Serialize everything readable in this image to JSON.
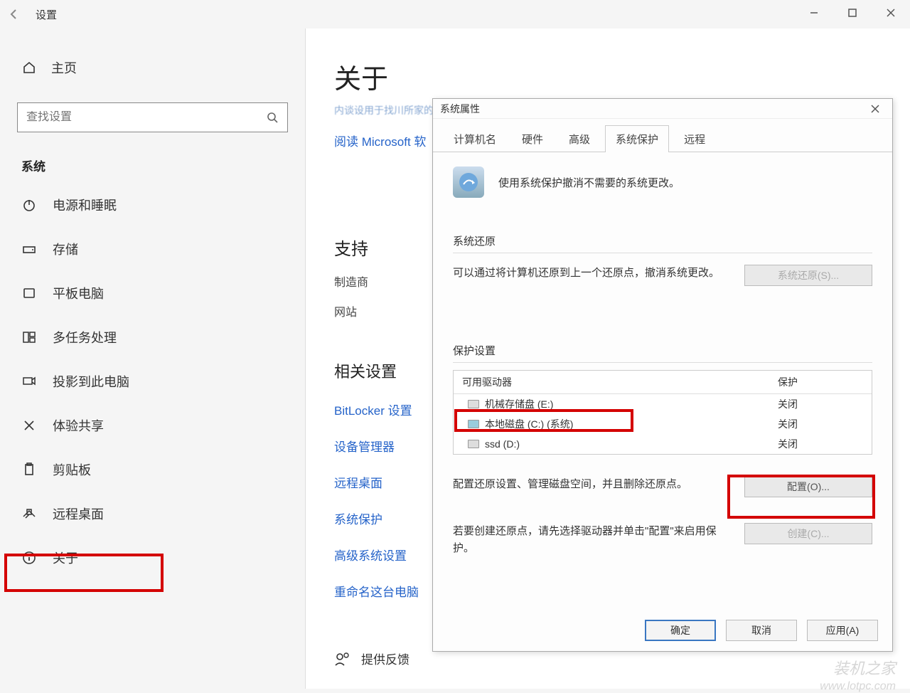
{
  "titlebar": {
    "title": "设置"
  },
  "sidebar": {
    "home": "主页",
    "search_placeholder": "查找设置",
    "section": "系统",
    "items": [
      {
        "label": "电源和睡眠"
      },
      {
        "label": "存储"
      },
      {
        "label": "平板电脑"
      },
      {
        "label": "多任务处理"
      },
      {
        "label": "投影到此电脑"
      },
      {
        "label": "体验共享"
      },
      {
        "label": "剪贴板"
      },
      {
        "label": "远程桌面"
      },
      {
        "label": "关于"
      }
    ]
  },
  "main": {
    "title": "关于",
    "blurred_text": "内谈设用于找川所家的 Microsoft 所家的议",
    "link": "阅读 Microsoft 软",
    "support_title": "支持",
    "manufacturer": "制造商",
    "website": "网站",
    "related_title": "相关设置",
    "related": [
      "BitLocker 设置",
      "设备管理器",
      "远程桌面",
      "系统保护",
      "高级系统设置",
      "重命名这台电脑"
    ],
    "feedback": "提供反馈"
  },
  "dialog": {
    "title": "系统属性",
    "tabs": [
      "计算机名",
      "硬件",
      "高级",
      "系统保护",
      "远程"
    ],
    "active_tab": "系统保护",
    "protect_desc": "使用系统保护撤消不需要的系统更改。",
    "restore_title": "系统还原",
    "restore_desc": "可以通过将计算机还原到上一个还原点，撤消系统更改。",
    "restore_btn": "系统还原(S)...",
    "settings_title": "保护设置",
    "table": {
      "col1": "可用驱动器",
      "col2": "保护",
      "rows": [
        {
          "name": "机械存储盘 (E:)",
          "status": "关闭"
        },
        {
          "name": "本地磁盘 (C:) (系统)",
          "status": "关闭"
        },
        {
          "name": "ssd (D:)",
          "status": "关闭"
        }
      ]
    },
    "config_desc": "配置还原设置、管理磁盘空间，并且删除还原点。",
    "config_btn": "配置(O)...",
    "create_desc": "若要创建还原点，请先选择驱动器并单击\"配置\"来启用保护。",
    "create_btn": "创建(C)...",
    "ok": "确定",
    "cancel": "取消",
    "apply": "应用(A)"
  },
  "watermark": {
    "brand": "装机之家",
    "url": "www.lotpc.com"
  }
}
